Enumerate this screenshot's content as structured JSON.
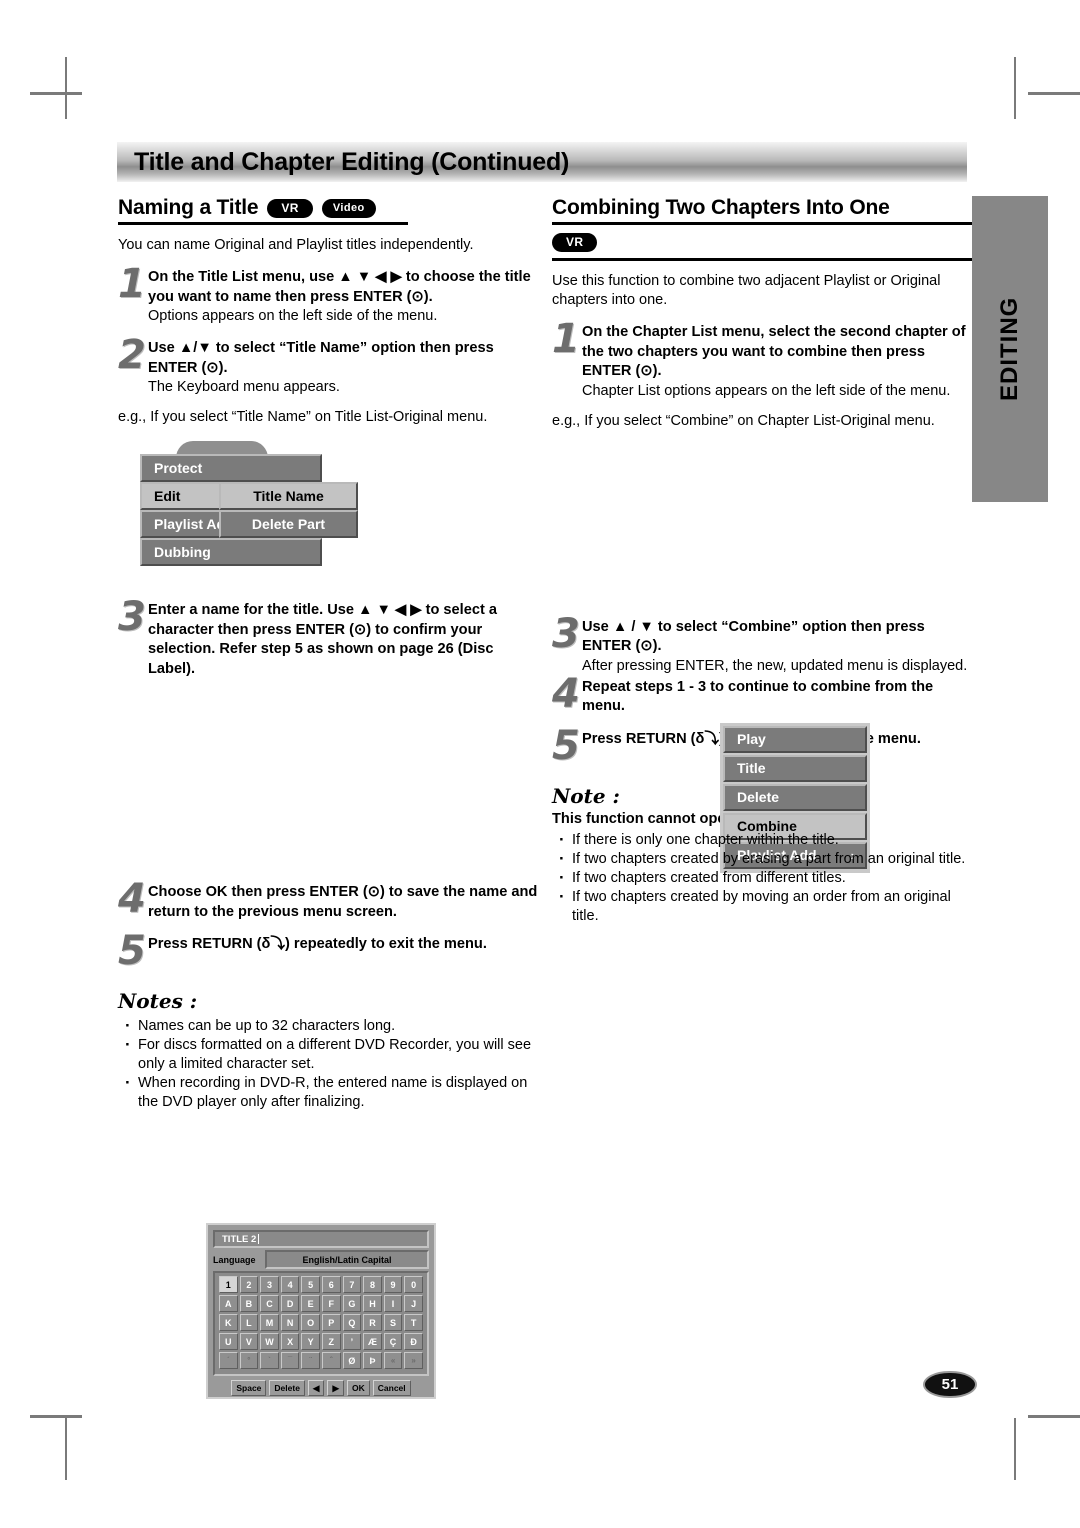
{
  "page": {
    "header_title": "Title and Chapter Editing (Continued)",
    "side_tab": "EDITING",
    "page_number": "51"
  },
  "left_column": {
    "heading": "Naming a Title",
    "badges": [
      "VR",
      "Video"
    ],
    "intro": "You can name Original and Playlist titles independently.",
    "steps": [
      {
        "num": "1",
        "bold": "On the Title List menu, use ▲ ▼ ◀ ▶ to choose the title you want to name then press ENTER (⊙).",
        "sub": "Options appears on the left side of the menu."
      },
      {
        "num": "2",
        "bold": "Use ▲/▼ to select “Title Name” option then press ENTER (⊙).",
        "sub": "The Keyboard menu appears."
      }
    ],
    "example": "e.g., If you select “Title Name” on Title List-Original menu.",
    "osd_menu": {
      "items": [
        "Protect",
        "Edit",
        "Playlist Ad",
        "Dubbing"
      ],
      "selected": "Edit",
      "submenu": [
        "Title Name",
        "Delete Part"
      ],
      "submenu_selected": "Title Name"
    },
    "step3": {
      "num": "3",
      "bold": "Enter a name for the title. Use ▲ ▼ ◀ ▶ to select a character then press ENTER (⊙) to confirm your selection. Refer step 5 as shown on page 26 (Disc Label)."
    },
    "keyboard": {
      "title_value": "TITLE 2",
      "language_label": "Language",
      "language_value": "English/Latin Capital",
      "selected_key": "1",
      "rows": [
        [
          "1",
          "2",
          "3",
          "4",
          "5",
          "6",
          "7",
          "8",
          "9",
          "0"
        ],
        [
          "A",
          "B",
          "C",
          "D",
          "E",
          "F",
          "G",
          "H",
          "I",
          "J"
        ],
        [
          "K",
          "L",
          "M",
          "N",
          "O",
          "P",
          "Q",
          "R",
          "S",
          "T"
        ],
        [
          "U",
          "V",
          "W",
          "X",
          "Y",
          "Z",
          "’",
          "Æ",
          "Ç",
          "Ð"
        ],
        [
          "´",
          "°",
          "`",
          "¯",
          "¨",
          "ˆ",
          "Ø",
          "Þ",
          "«",
          "»"
        ]
      ],
      "bottom_keys": [
        "Space",
        "Delete",
        "◀",
        "▶",
        "OK",
        "Cancel"
      ]
    },
    "steps_tail": [
      {
        "num": "4",
        "bold": "Choose OK then press ENTER (⊙) to save the name and return to the previous menu screen."
      },
      {
        "num": "5",
        "bold": "Press RETURN (δ⤵) repeatedly to exit the menu."
      }
    ],
    "notes_head": "Notes :",
    "notes": [
      "Names can be up to 32 characters long.",
      "For discs formatted on a different DVD Recorder, you will see only a limited character set.",
      "When recording in DVD-R, the entered name is displayed on the DVD player only after finalizing."
    ]
  },
  "right_column": {
    "heading": "Combining Two Chapters Into One",
    "badges": [
      "VR"
    ],
    "intro": "Use this function to combine two adjacent Playlist or Original chapters into one.",
    "steps": [
      {
        "num": "1",
        "bold": "On the Chapter List menu, select the second chapter of the two chapters you want to combine then press ENTER (⊙).",
        "sub": "Chapter List options appears on the left side of the menu."
      }
    ],
    "example": "e.g., If you select “Combine” on Chapter List-Original menu.",
    "osd_menu": {
      "items": [
        "Play",
        "Title",
        "Delete",
        "Combine",
        "Playlist Add"
      ],
      "selected": "Combine",
      "arrow_item": "Playlist Add",
      "arrow_glyph": "›"
    },
    "steps_tail": [
      {
        "num": "3",
        "bold": "Use ▲ / ▼ to select “Combine” option then press ENTER (⊙).",
        "sub": "After pressing ENTER, the new, updated menu is displayed."
      },
      {
        "num": "4",
        "bold": "Repeat steps 1 - 3 to continue to combine from the menu."
      },
      {
        "num": "5",
        "bold": "Press RETURN (δ⤵) repeatedly to exit the menu."
      }
    ],
    "note_head": "Note :",
    "note_bold": "This function cannot operate listed as below;",
    "note_items": [
      "If there is only one chapter within the title.",
      "If two chapters created by erasing a part from an original title.",
      "If two chapters created from different titles.",
      "If two chapters created by moving an order from an original title."
    ]
  }
}
